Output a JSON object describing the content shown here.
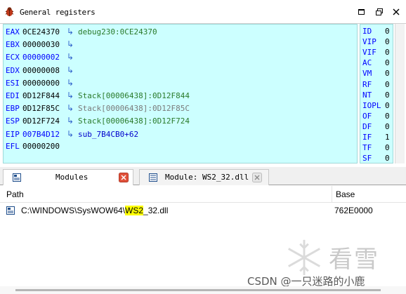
{
  "titlebar": {
    "title": "General registers",
    "icon": "bug-icon",
    "buttons": [
      "maximize-icon",
      "restore-icon",
      "close-icon"
    ]
  },
  "registers": [
    {
      "name": "EAX",
      "value": "0CE24370",
      "changed": false,
      "target": "debug230:0CE24370",
      "target_style": "data"
    },
    {
      "name": "EBX",
      "value": "00000030",
      "changed": false,
      "target": "",
      "target_style": ""
    },
    {
      "name": "ECX",
      "value": "00000002",
      "changed": true,
      "target": "",
      "target_style": ""
    },
    {
      "name": "EDX",
      "value": "00000008",
      "changed": false,
      "target": "",
      "target_style": ""
    },
    {
      "name": "ESI",
      "value": "00000000",
      "changed": false,
      "target": "",
      "target_style": ""
    },
    {
      "name": "EDI",
      "value": "0D12F844",
      "changed": false,
      "target": "Stack[00006438]:0D12F844",
      "target_style": "data"
    },
    {
      "name": "EBP",
      "value": "0D12F85C",
      "changed": false,
      "target": "Stack[00006438]:0D12F85C",
      "target_style": "gray"
    },
    {
      "name": "ESP",
      "value": "0D12F724",
      "changed": false,
      "target": "Stack[00006438]:0D12F724",
      "target_style": "data"
    },
    {
      "name": "EIP",
      "value": "007B4D12",
      "changed": true,
      "target": "sub_7B4CB0+62",
      "target_style": "code"
    },
    {
      "name": "EFL",
      "value": "00000200",
      "changed": false,
      "target": null,
      "target_style": ""
    }
  ],
  "arrow_glyph": "↳",
  "flags": [
    {
      "name": "ID",
      "value": "0"
    },
    {
      "name": "VIP",
      "value": "0"
    },
    {
      "name": "VIF",
      "value": "0"
    },
    {
      "name": "AC",
      "value": "0"
    },
    {
      "name": "VM",
      "value": "0"
    },
    {
      "name": "RF",
      "value": "0"
    },
    {
      "name": "NT",
      "value": "0"
    },
    {
      "name": "IOPL",
      "value": "0"
    },
    {
      "name": "OF",
      "value": "0"
    },
    {
      "name": "DF",
      "value": "0"
    },
    {
      "name": "IF",
      "value": "1"
    },
    {
      "name": "TF",
      "value": "0"
    },
    {
      "name": "SF",
      "value": "0"
    }
  ],
  "tabs": [
    {
      "label": "Modules",
      "active": true,
      "close_color": "#e0503a"
    },
    {
      "label": "Module: WS2_32.dll",
      "active": false,
      "close_color": "#bdbdbd"
    }
  ],
  "modules": {
    "columns": {
      "path": "Path",
      "base": "Base"
    },
    "rows": [
      {
        "path_before": "C:\\WINDOWS\\SysWOW64\\",
        "path_highlight": "WS2",
        "path_after": "_32.dll",
        "base": "762E0000"
      }
    ]
  },
  "watermark": {
    "text": "看雪"
  },
  "credit": "CSDN @一只迷路的小鹿",
  "colors": {
    "register_bg": "#ccffff",
    "register_name": "#0000ff",
    "changed_value": "#0000ff",
    "stack_ref": "#2a7a2a",
    "highlight": "#ffff00"
  }
}
